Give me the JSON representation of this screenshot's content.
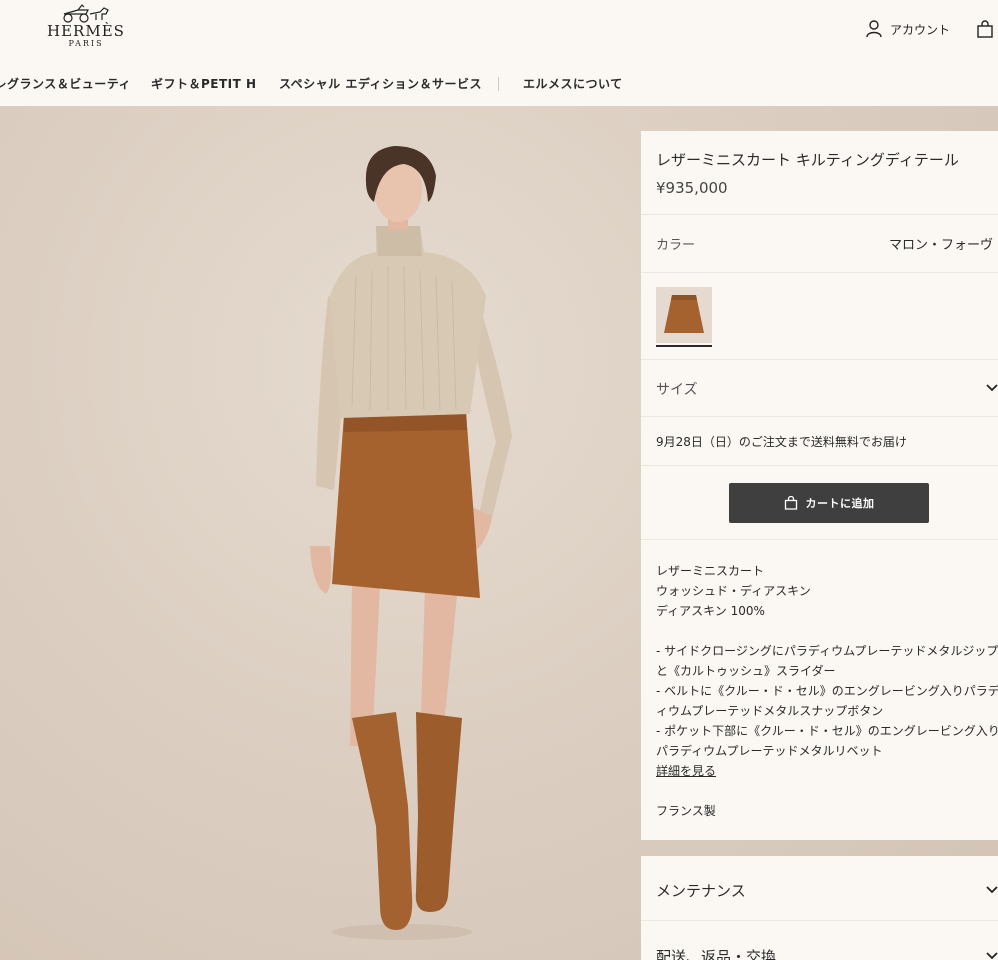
{
  "header": {
    "brand": "HERMÈS",
    "brand_city": "PARIS",
    "account_label": "アカウント",
    "nav": [
      "フレグランス＆ビューティ",
      "ギフト＆PETIT H",
      "スペシャル エディション＆サービス",
      "エルメスについて"
    ]
  },
  "product": {
    "title": "レザーミニスカート キルティングディテール",
    "price": "¥935,000",
    "color_label": "カラー",
    "color_value": "マロン・フォーヴ",
    "size_label": "サイズ",
    "delivery_note": "9月28日（日）のご注文まで送料無料でお届け",
    "add_to_cart": "カートに追加",
    "description": {
      "line1": "レザーミニスカート",
      "line2": "ウォッシュド・ディアスキン",
      "line3": "ディアスキン 100%",
      "bullet1a": "- サイドクロージングにパラディウムプレーテッドメタルジップ",
      "bullet1b": "と《カルトゥッシュ》スライダー",
      "bullet2a": "- ベルトに《クルー・ド・セル》のエングレービング入りパラデ",
      "bullet2b": "ィウムプレーテッドメタルスナップボタン",
      "bullet3a": "- ポケット下部に《クルー・ド・セル》のエングレービング入り",
      "bullet3b": "パラディウムプレーテッドメタルリベット",
      "details_link": "詳細を見る",
      "origin": "フランス製"
    },
    "accordions": {
      "maintenance": "メンテナンス",
      "shipping": "配送、返品・交換"
    }
  },
  "colors": {
    "leather": "#a5622f",
    "sweater": "#d8c9b5",
    "button": "#3f3f3f"
  }
}
